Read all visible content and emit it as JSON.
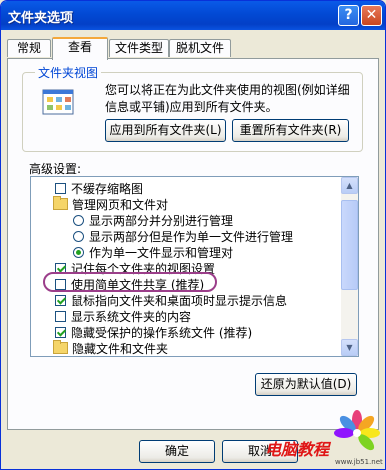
{
  "window": {
    "title": "文件夹选项",
    "help": "?",
    "close": "✕"
  },
  "tabs": [
    "常规",
    "查看",
    "文件类型",
    "脱机文件"
  ],
  "folder_views": {
    "title": "文件夹视图",
    "description": "您可以将正在为此文件夹使用的视图(例如详细信息或平铺)应用到所有文件夹。",
    "apply_all": "应用到所有文件夹(L)",
    "reset_all": "重置所有文件夹(R)"
  },
  "advanced": {
    "label": "高级设置:",
    "items": [
      {
        "type": "checkbox",
        "checked": false,
        "label": "不缓存缩略图"
      },
      {
        "type": "folder",
        "label": "管理网页和文件对"
      },
      {
        "type": "radio",
        "selected": false,
        "label": "显示两部分并分别进行管理"
      },
      {
        "type": "radio",
        "selected": false,
        "label": "显示两部分但是作为单一文件进行管理"
      },
      {
        "type": "radio",
        "selected": true,
        "label": "作为单一文件显示和管理对"
      },
      {
        "type": "checkbox",
        "checked": true,
        "label": "记住每个文件夹的视图设置"
      },
      {
        "type": "checkbox",
        "checked": false,
        "label": "使用简单文件共享 (推荐)"
      },
      {
        "type": "checkbox",
        "checked": true,
        "label": "鼠标指向文件夹和桌面项时显示提示信息"
      },
      {
        "type": "checkbox",
        "checked": false,
        "label": "显示系统文件夹的内容"
      },
      {
        "type": "checkbox",
        "checked": true,
        "label": "隐藏受保护的操作系统文件 (推荐)"
      },
      {
        "type": "folder",
        "label": "隐藏文件和文件夹"
      }
    ],
    "restore_defaults": "还原为默认值(D)"
  },
  "footer": {
    "ok": "确定",
    "cancel": "取消"
  },
  "watermark": {
    "text": "电脑教程",
    "url": "www.jb51.net"
  }
}
